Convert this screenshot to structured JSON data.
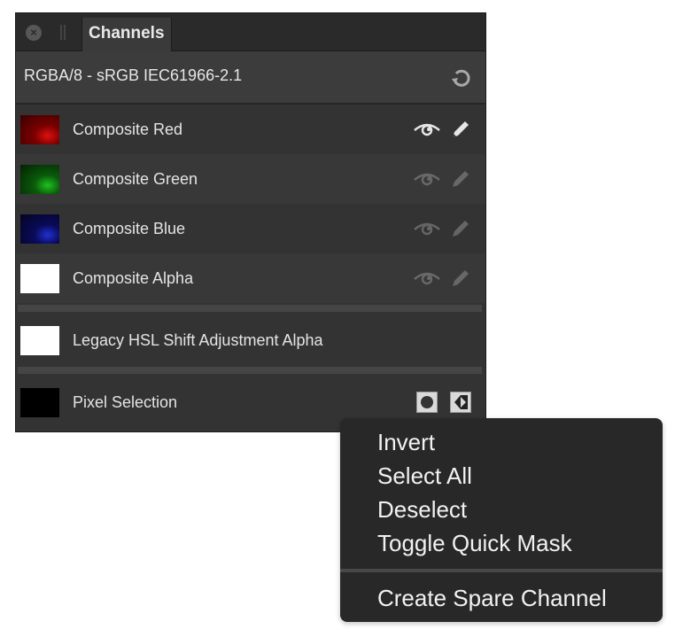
{
  "panel": {
    "tab_label": "Channels",
    "close_icon": "close-icon",
    "grip_icon": "drag-grip-icon",
    "header_text": "RGBA/8 - sRGB IEC61966-2.1",
    "refresh_icon": "refresh-icon",
    "channels": [
      {
        "label": "Composite Red",
        "thumb_color": "#7a0000",
        "visible_active": true,
        "edit_active": true
      },
      {
        "label": "Composite Green",
        "thumb_color": "#0a4a0a",
        "visible_active": false,
        "edit_active": false
      },
      {
        "label": "Composite Blue",
        "thumb_color": "#0a0a4a",
        "visible_active": false,
        "edit_active": false
      },
      {
        "label": "Composite Alpha",
        "thumb_color": "#ffffff",
        "visible_active": false,
        "edit_active": false
      }
    ],
    "spare_channel": {
      "label": "Legacy HSL Shift Adjustment Alpha",
      "thumb_color": "#ffffff"
    },
    "pixel_selection": {
      "label": "Pixel Selection",
      "thumb_color": "#000000",
      "buttons": [
        "quick-mask-icon",
        "invert-selection-icon"
      ]
    }
  },
  "context_menu": {
    "items": [
      "Invert",
      "Select All",
      "Deselect",
      "Toggle Quick Mask"
    ],
    "after_separator": [
      "Create Spare Channel"
    ]
  }
}
